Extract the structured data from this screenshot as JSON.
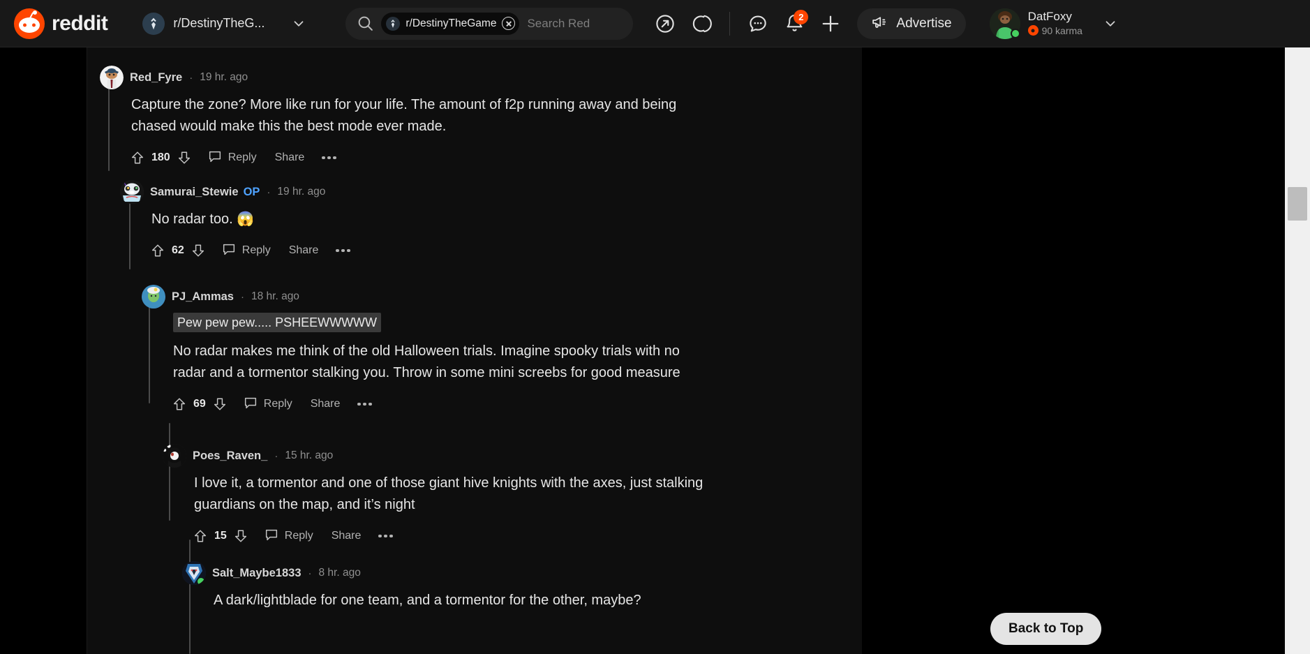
{
  "header": {
    "brand": "reddit",
    "logo_icon": "reddit-logo-icon",
    "subreddit_switcher": {
      "label": "r/DestinyTheG...",
      "avatar_icon": "destiny-tricorn-icon",
      "chevron_icon": "chevron-down-icon"
    },
    "search": {
      "search_icon": "search-icon",
      "pill_label": "r/DestinyTheGame",
      "pill_icon": "destiny-tricorn-icon",
      "pill_clear_icon": "clear-x-icon",
      "placeholder": "Search Red"
    },
    "icons": [
      {
        "name": "popular-arrow-icon",
        "label": "Popular"
      },
      {
        "name": "reddit-coins-icon",
        "label": "Coins"
      },
      {
        "name": "chat-bubble-icon",
        "label": "Chat"
      },
      {
        "name": "notification-bell-icon",
        "label": "Notifications",
        "badge": "2"
      },
      {
        "name": "create-post-plus-icon",
        "label": "Create"
      }
    ],
    "advertise": {
      "label": "Advertise",
      "icon": "megaphone-icon"
    },
    "user": {
      "name": "DatFoxy",
      "karma": "90 karma",
      "karma_icon": "karma-orb-icon",
      "avatar_icon": "user-avatar",
      "status": "online",
      "chevron_icon": "chevron-down-icon"
    }
  },
  "actions": {
    "upvote_icon": "upvote-arrow-icon",
    "downvote_icon": "downvote-arrow-icon",
    "comment_icon": "comment-bubble-icon",
    "reply": "Reply",
    "share": "Share",
    "more_icon": "more-options-icon",
    "separator": "·"
  },
  "comments": [
    {
      "id": "red-fyre",
      "author": "Red_Fyre",
      "op": false,
      "time": "19 hr. ago",
      "body": "Capture the zone? More like run for your life. The amount of f2p running away and being chased would make this the best mode ever made.",
      "score": "180",
      "depth": 0
    },
    {
      "id": "samurai-stewie",
      "author": "Samurai_Stewie",
      "op": true,
      "op_label": "OP",
      "time": "19 hr. ago",
      "body": "No radar too. 😱",
      "score": "62",
      "depth": 1
    },
    {
      "id": "pj-ammas",
      "author": "PJ_Ammas",
      "op": false,
      "time": "18 hr. ago",
      "code_block": "Pew pew pew..... PSHEEWWWWW",
      "body": "No radar makes me think of the old Halloween trials. Imagine spooky trials with no radar and a tormentor stalking you. Throw in some mini screebs for good measure",
      "score": "69",
      "depth": 2
    },
    {
      "id": "poes-raven",
      "author": "Poes_Raven_",
      "op": false,
      "time": "15 hr. ago",
      "body": "I love it, a tormentor and one of those giant hive knights with the axes, just stalking guardians on the map, and it’s night",
      "score": "15",
      "depth": 3
    },
    {
      "id": "salt-maybe",
      "author": "Salt_Maybe1833",
      "op": false,
      "time": "8 hr. ago",
      "body": "A dark/lightblade for one team, and a tormentor for the other, maybe?",
      "score": "",
      "depth": 4
    }
  ],
  "back_to_top": {
    "label": "Back to Top"
  },
  "colors": {
    "accent": "#ff4500",
    "op_blue": "#4fa3ff",
    "page_bg": "#000000",
    "panel_bg": "#0e0e0e",
    "header_bg": "#181818"
  }
}
